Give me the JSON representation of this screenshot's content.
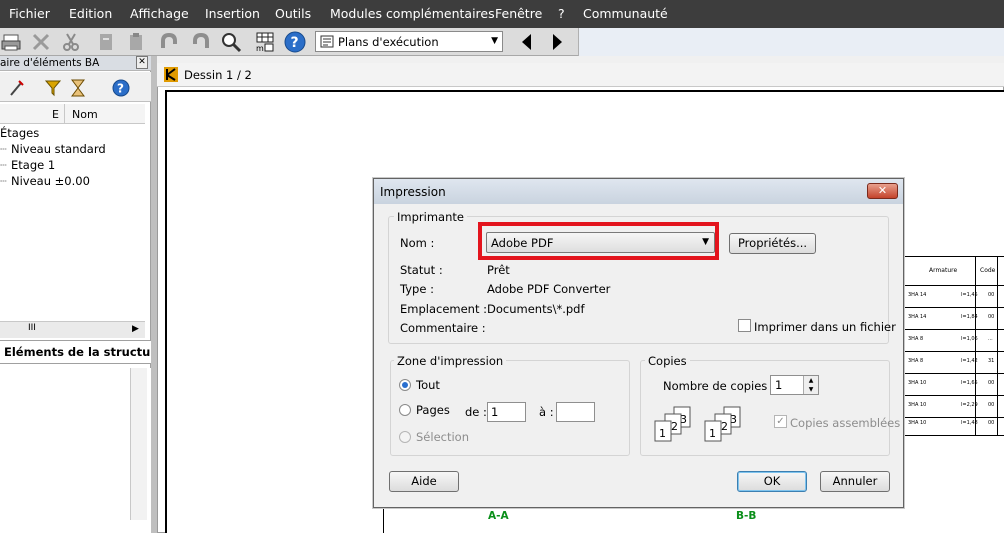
{
  "menu": [
    "Fichier",
    "Edition",
    "Affichage",
    "Insertion",
    "Outils",
    "Modules complémentaires",
    "Fenêtre",
    "?",
    "Communauté"
  ],
  "toolbar": {
    "combo_value": "Plans d'exécution",
    "icons": [
      "print-icon",
      "delete-icon",
      "cut-icon",
      "copy-icon",
      "paste-icon",
      "undo-icon",
      "redo-icon",
      "zoom-icon",
      "grid-icon",
      "help-icon",
      "arrow-left-icon",
      "arrow-right-icon"
    ]
  },
  "left_panel": {
    "title": "aire d'éléments BA",
    "columns": [
      "E",
      "Nom"
    ],
    "tree": [
      "Étages",
      "Niveau standard",
      "Etage 1",
      "Niveau ±0.00"
    ],
    "scroll_label": "III",
    "tab": "Eléments de la structure"
  },
  "document": {
    "tab": "Dessin 1 / 2",
    "section_labels": [
      "A-A",
      "B-B"
    ],
    "table_headers": [
      "Armature",
      "Code"
    ],
    "table_rows": [
      [
        "3HA 14",
        "l=1,45",
        "00"
      ],
      [
        "3HA 14",
        "l=1,84",
        "00"
      ],
      [
        "3HA 8",
        "l=1,06",
        "..."
      ],
      [
        "3HA 8",
        "l=1,42",
        "31"
      ],
      [
        "3HA 10",
        "l=1,65",
        "00"
      ],
      [
        "3HA 10",
        "l=2,29",
        "00"
      ],
      [
        "3HA 10",
        "l=1,48",
        "00"
      ]
    ]
  },
  "dialog": {
    "title": "Impression",
    "close": "✕",
    "printer_group": "Imprimante",
    "name_label": "Nom :",
    "printer_name": "Adobe PDF",
    "properties_button": "Propriétés...",
    "status_label": "Statut :",
    "status_value": "Prêt",
    "type_label": "Type :",
    "type_value": "Adobe PDF Converter",
    "location_label": "Emplacement :",
    "location_value": "Documents\\*.pdf",
    "comment_label": "Commentaire :",
    "print_to_file": "Imprimer dans un fichier",
    "print_zone_group": "Zone d'impression",
    "all_label": "Tout",
    "pages_label": "Pages",
    "from_label": "de :",
    "from_value": "1",
    "to_label": "à :",
    "to_value": "",
    "selection_label": "Sélection",
    "copies_group": "Copies",
    "copies_label": "Nombre de copies :",
    "copies_value": "1",
    "collate_label": "Copies assemblées",
    "help_button": "Aide",
    "ok_button": "OK",
    "cancel_button": "Annuler",
    "highlight_color": "#e3141d",
    "accent": "#2a6fcf"
  }
}
